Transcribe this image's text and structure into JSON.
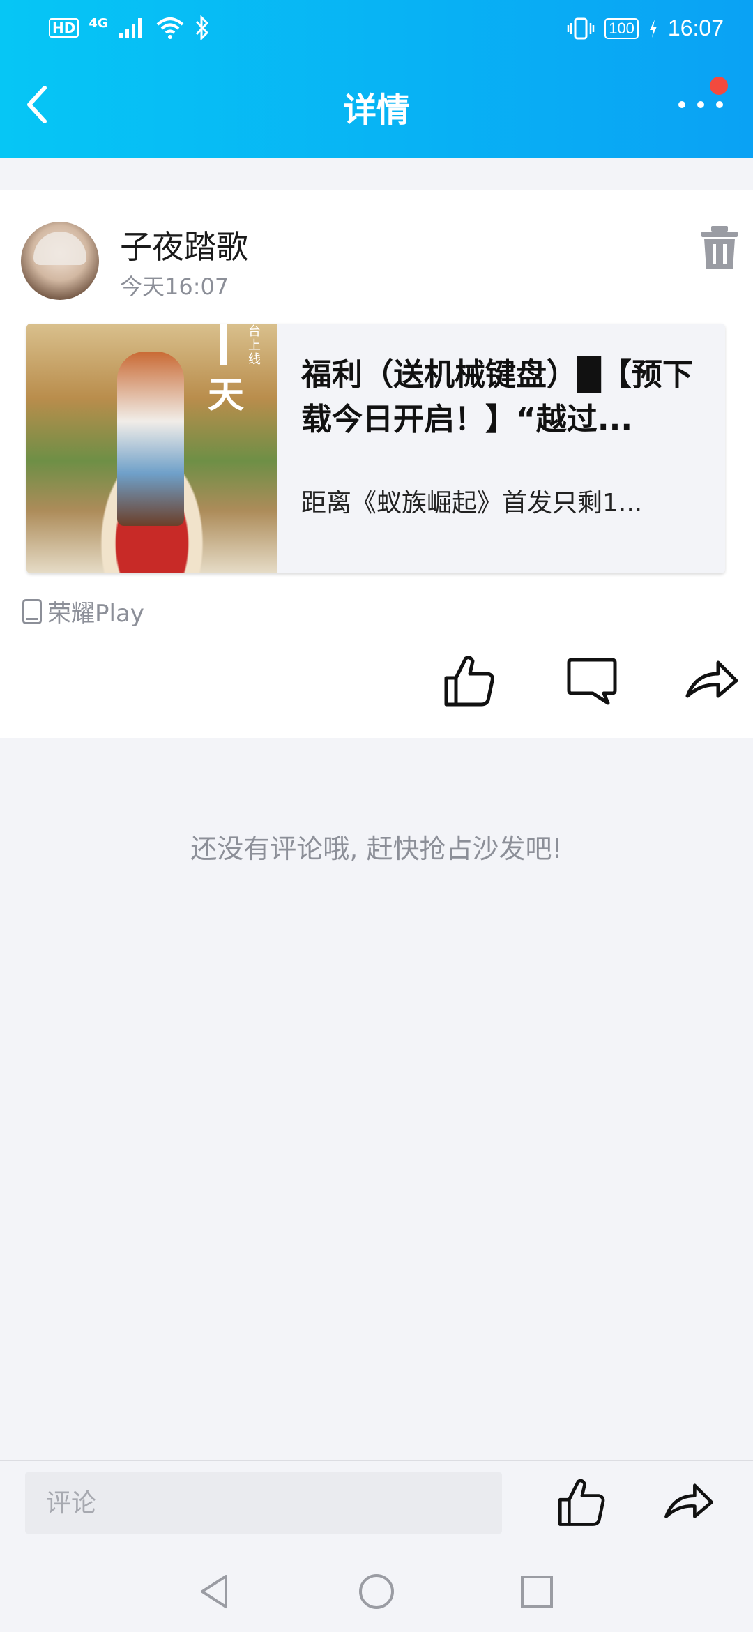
{
  "status_bar": {
    "left_labels": [
      "HD",
      "4G"
    ],
    "battery": "100",
    "time": "16:07"
  },
  "header": {
    "title": "详情",
    "has_notification_dot": true
  },
  "post": {
    "username": "子夜踏歌",
    "time": "今天16:07",
    "shared_item": {
      "title": "福利（送机械键盘）█【预下载今日开启！】“越过...",
      "description": "距离《蚁族崛起》首发只剩1...",
      "thumbnail_text": "天",
      "thumbnail_caption": "台上线"
    },
    "source": "荣耀Play"
  },
  "comments": {
    "empty_text": "还没有评论哦, 赶快抢占沙发吧!"
  },
  "bottom_bar": {
    "comment_placeholder": "评论"
  },
  "icons": {
    "back": "chevron-left-icon",
    "more": "more-dots-icon",
    "delete": "trash-icon",
    "like": "thumbs-up-icon",
    "comment": "comment-icon",
    "share": "share-arrow-icon"
  },
  "colors": {
    "header_start": "#06c6f5",
    "header_end": "#0aa2f4",
    "notification": "#f24a3e",
    "muted_text": "#8c8f98"
  }
}
